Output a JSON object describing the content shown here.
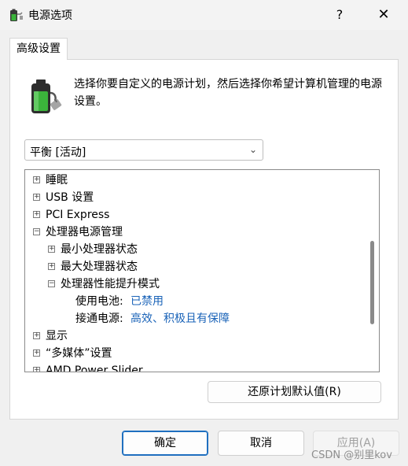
{
  "window": {
    "title": "电源选项",
    "help": "?",
    "close": "✕"
  },
  "tab": {
    "label": "高级设置"
  },
  "description": "选择你要自定义的电源计划，然后选择你希望计算机管理的电源设置。",
  "plan_select": {
    "value": "平衡 [活动]",
    "chevron": "⌄"
  },
  "tree": {
    "items": [
      {
        "expander": "+",
        "label": "睡眠"
      },
      {
        "expander": "+",
        "label": "USB 设置"
      },
      {
        "expander": "+",
        "label": "PCI Express"
      },
      {
        "expander": "−",
        "label": "处理器电源管理"
      },
      {
        "expander": "+",
        "label": "最小处理器状态"
      },
      {
        "expander": "+",
        "label": "最大处理器状态"
      },
      {
        "expander": "−",
        "label": "处理器性能提升模式"
      },
      {
        "label": "使用电池:",
        "value": "已禁用"
      },
      {
        "label": "接通电源:",
        "value": "高效、积极且有保障"
      },
      {
        "expander": "+",
        "label": "显示"
      },
      {
        "expander": "+",
        "label": "“多媒体”设置"
      },
      {
        "expander": "+",
        "label": "AMD Power Slider"
      }
    ]
  },
  "buttons": {
    "restore": "还原计划默认值(R)",
    "ok": "确定",
    "cancel": "取消",
    "apply": "应用(A)"
  },
  "watermark": "CSDN @别里kov",
  "colors": {
    "value_blue": "#1a63b8",
    "accent": "#1f6fbf",
    "battery_green": "#3bb43b"
  }
}
